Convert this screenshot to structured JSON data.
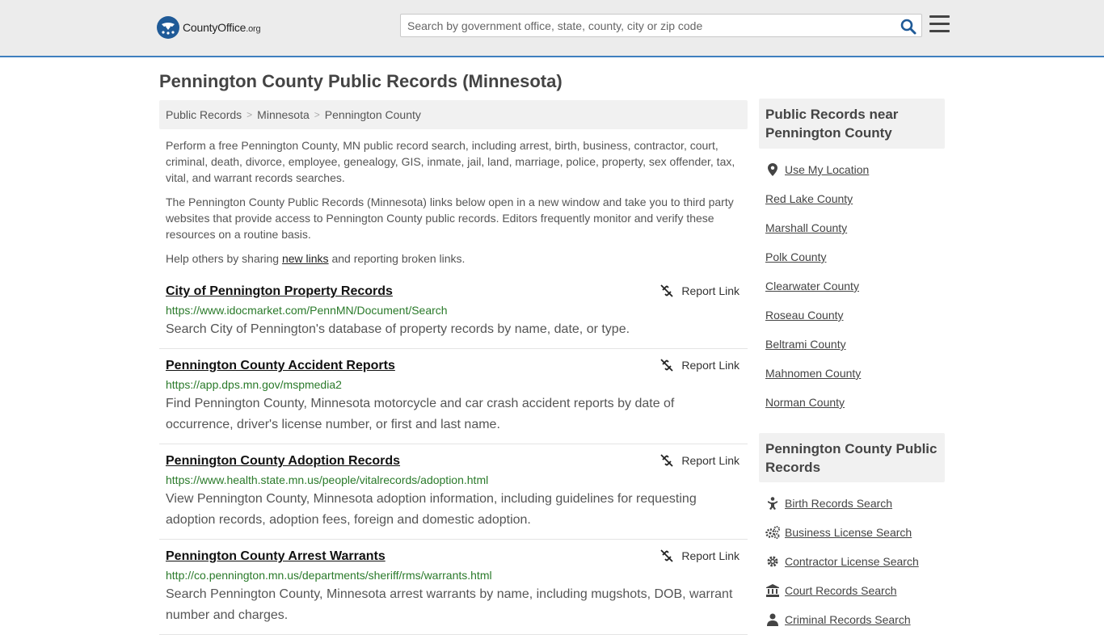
{
  "header": {
    "logo_main": "CountyOffice",
    "logo_suffix": ".org",
    "search_placeholder": "Search by government office, state, county, city or zip code"
  },
  "page_title": "Pennington County Public Records (Minnesota)",
  "breadcrumb": [
    "Public Records",
    "Minnesota",
    "Pennington County"
  ],
  "breadcrumb_sep": ">",
  "intro": {
    "p1": "Perform a free Pennington County, MN public record search, including arrest, birth, business, contractor, court, criminal, death, divorce, employee, genealogy, GIS, inmate, jail, land, marriage, police, property, sex offender, tax, vital, and warrant records searches.",
    "p2": "The Pennington County Public Records (Minnesota) links below open in a new window and take you to third party websites that provide access to Pennington County public records. Editors frequently monitor and verify these resources on a routine basis.",
    "p3_before": "Help others by sharing ",
    "p3_link": "new links",
    "p3_after": " and reporting broken links."
  },
  "report_label": "Report Link",
  "records": [
    {
      "title": "City of Pennington Property Records",
      "url": "https://www.idocmarket.com/PennMN/Document/Search",
      "desc": "Search City of Pennington's database of property records by name, date, or type."
    },
    {
      "title": "Pennington County Accident Reports",
      "url": "https://app.dps.mn.gov/mspmedia2",
      "desc": "Find Pennington County, Minnesota motorcycle and car crash accident reports by date of occurrence, driver's license number, or first and last name."
    },
    {
      "title": "Pennington County Adoption Records",
      "url": "https://www.health.state.mn.us/people/vitalrecords/adoption.html",
      "desc": "View Pennington County, Minnesota adoption information, including guidelines for requesting adoption records, adoption fees, foreign and domestic adoption."
    },
    {
      "title": "Pennington County Arrest Warrants",
      "url": "http://co.pennington.mn.us/departments/sheriff/rms/warrants.html",
      "desc": "Search Pennington County, Minnesota arrest warrants by name, including mugshots, DOB, warrant number and charges."
    }
  ],
  "sidebar": {
    "near_title": "Public Records near Pennington County",
    "use_location": "Use My Location",
    "near_items": [
      "Red Lake County",
      "Marshall County",
      "Polk County",
      "Clearwater County",
      "Roseau County",
      "Beltrami County",
      "Mahnomen County",
      "Norman County"
    ],
    "records_title": "Pennington County Public Records",
    "record_items": [
      {
        "label": "Birth Records Search",
        "icon": "baby-icon"
      },
      {
        "label": "Business License Search",
        "icon": "gears-icon"
      },
      {
        "label": "Contractor License Search",
        "icon": "gear-icon"
      },
      {
        "label": "Court Records Search",
        "icon": "courthouse-icon"
      },
      {
        "label": "Criminal Records Search",
        "icon": "criminal-icon"
      }
    ]
  },
  "colors": {
    "header_bg": "#ececec",
    "header_border": "#3f7fbf",
    "logo_blue": "#1f5a97",
    "url_green": "#2a7a2a",
    "search_icon": "#1f5a97"
  }
}
